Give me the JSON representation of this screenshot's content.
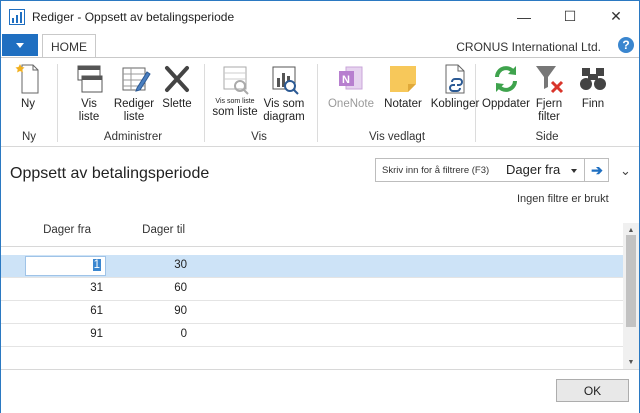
{
  "window": {
    "title": "Rediger - Oppsett av betalingsperiode",
    "minimize_glyph": "—",
    "maximize_glyph": "☐",
    "close_glyph": "✕"
  },
  "ribbon_tabs": {
    "home": "HOME"
  },
  "company": "CRONUS International Ltd.",
  "help_glyph": "?",
  "ribbon": {
    "groups": {
      "ny": "Ny",
      "administrer": "Administrer",
      "vis": "Vis",
      "vis_vedlagt": "Vis vedlagt",
      "side": "Side"
    },
    "buttons": {
      "ny": "Ny",
      "vis_liste_1": "Vis",
      "vis_liste_2": "liste",
      "rediger_liste_1": "Rediger",
      "rediger_liste_2": "liste",
      "slette": "Slette",
      "vis_som_liste_1": "Vis som liste",
      "vis_som_liste_2": "som liste",
      "vis_som_diagram_1": "Vis som",
      "vis_som_diagram_2": "diagram",
      "onenote": "OneNote",
      "notater": "Notater",
      "koblinger": "Koblinger",
      "oppdater": "Oppdater",
      "fjern_filter_1": "Fjern",
      "fjern_filter_2": "filter",
      "finn": "Finn"
    }
  },
  "page": {
    "title": "Oppsett av betalingsperiode",
    "filter_placeholder": "Skriv inn for å filtrere (F3)",
    "filter_field": "Dager fra",
    "go_glyph": "➔",
    "collapse_glyph": "⌄",
    "no_filter": "Ingen filtre er brukt"
  },
  "grid": {
    "columns": [
      "Dager fra",
      "Dager til"
    ],
    "rows": [
      {
        "dager_fra": "1",
        "dager_til": "30"
      },
      {
        "dager_fra": "31",
        "dager_til": "60"
      },
      {
        "dager_fra": "61",
        "dager_til": "90"
      },
      {
        "dager_fra": "91",
        "dager_til": "0"
      }
    ]
  },
  "footer": {
    "ok": "OK"
  },
  "colors": {
    "accent": "#1f6fc1",
    "selected_row": "#cde3f7"
  }
}
